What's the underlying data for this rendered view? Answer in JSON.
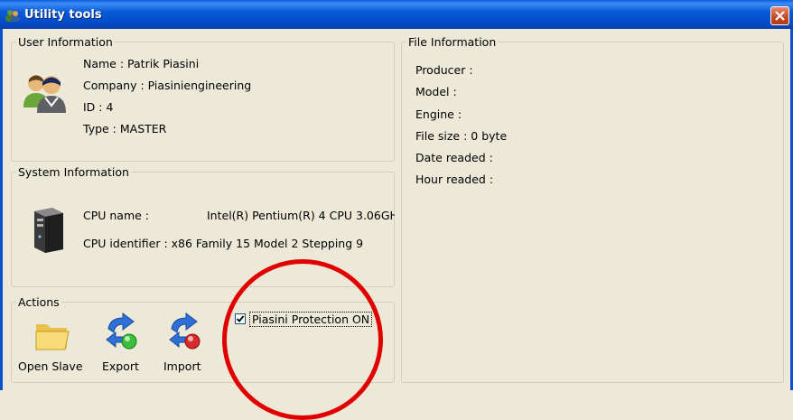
{
  "window": {
    "title": "Utility tools"
  },
  "user_info": {
    "group_title": "User Information",
    "name": "Name : Patrik Piasini",
    "company": "Company : Piasiniengineering",
    "id": "ID : 4",
    "type": "Type : MASTER"
  },
  "system_info": {
    "group_title": "System Information",
    "cpu_name_label": "CPU name :",
    "cpu_name_value": "Intel(R) Pentium(R) 4 CPU 3.06GH",
    "cpu_identifier": "CPU identifier : x86 Family 15 Model 2 Stepping 9"
  },
  "actions": {
    "group_title": "Actions",
    "open_slave": "Open Slave",
    "export": "Export",
    "import": "Import",
    "protection_label": "Piasini Protection ON",
    "protection_checked": true
  },
  "file_info": {
    "group_title": "File Information",
    "producer": "Producer :",
    "model": "Model :",
    "engine": "Engine :",
    "file_size": "File size : 0 byte",
    "date_readed": "Date readed :",
    "hour_readed": "Hour readed :"
  },
  "colors": {
    "annotation_circle": "#e10000",
    "title_bar": "#0a5bd8",
    "window_bg": "#ece9d8"
  }
}
